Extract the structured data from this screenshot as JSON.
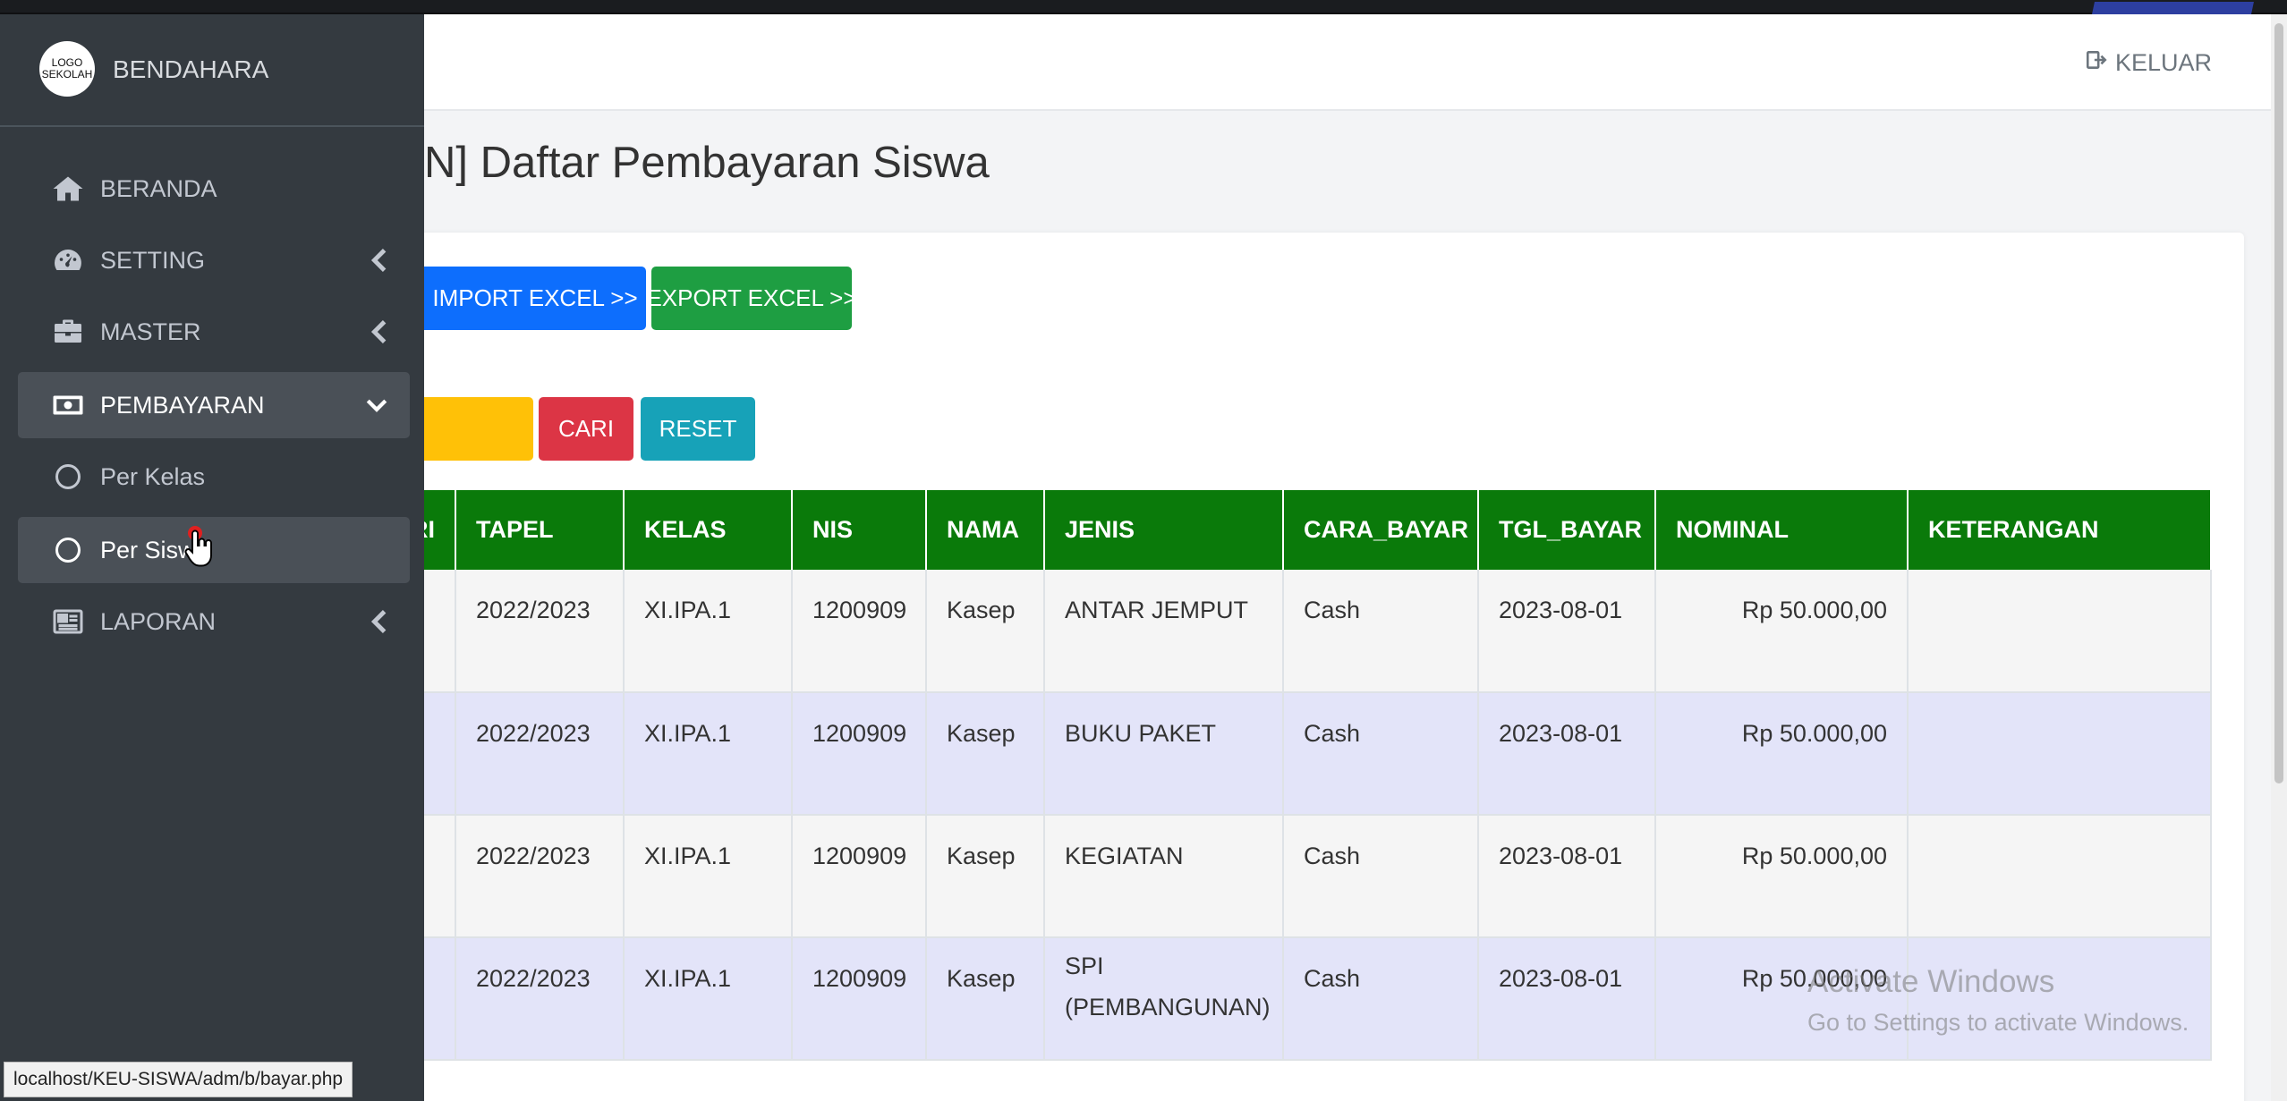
{
  "app": {
    "brand": "BENDAHARA",
    "logo_text_line1": "LOGO",
    "logo_text_line2": "SEKOLAH"
  },
  "sidebar": {
    "items": [
      {
        "label": "BERANDA",
        "icon": "home-icon"
      },
      {
        "label": "SETTING",
        "icon": "tachometer-icon"
      },
      {
        "label": "MASTER",
        "icon": "briefcase-icon"
      },
      {
        "label": "PEMBAYARAN",
        "icon": "money-bill-icon"
      },
      {
        "label": "Per Kelas",
        "icon": "circle-icon"
      },
      {
        "label": "Per Siswa",
        "icon": "circle-icon"
      },
      {
        "label": "LAPORAN",
        "icon": "newspaper-icon"
      }
    ]
  },
  "header": {
    "logout_label": "KELUAR"
  },
  "page": {
    "title": "N] Daftar Pembayaran Siswa"
  },
  "toolbar": {
    "import_label": "IMPORT EXCEL >>",
    "export_label": "EXPORT EXCEL >>",
    "search_label": "CARI",
    "reset_label": "RESET"
  },
  "table": {
    "columns": [
      "ENTRI",
      "TAPEL",
      "KELAS",
      "NIS",
      "NAMA",
      "JENIS",
      "CARA_BAYAR",
      "TGL_BAYAR",
      "NOMINAL",
      "KETERANGAN"
    ],
    "rows": [
      {
        "entri": "",
        "tapel": "2022/2023",
        "kelas": "XI.IPA.1",
        "nis": "1200909",
        "nama": "Kasep",
        "jenis": "ANTAR JEMPUT",
        "cara_bayar": "Cash",
        "tgl_bayar": "2023-08-01",
        "nominal": "Rp 50.000,00",
        "keterangan": ""
      },
      {
        "entri": "",
        "tapel": "2022/2023",
        "kelas": "XI.IPA.1",
        "nis": "1200909",
        "nama": "Kasep",
        "jenis": "BUKU PAKET",
        "cara_bayar": "Cash",
        "tgl_bayar": "2023-08-01",
        "nominal": "Rp 50.000,00",
        "keterangan": ""
      },
      {
        "entri": "",
        "tapel": "2022/2023",
        "kelas": "XI.IPA.1",
        "nis": "1200909",
        "nama": "Kasep",
        "jenis": "KEGIATAN",
        "cara_bayar": "Cash",
        "tgl_bayar": "2023-08-01",
        "nominal": "Rp 50.000,00",
        "keterangan": ""
      },
      {
        "entri": "",
        "tapel": "2022/2023",
        "kelas": "XI.IPA.1",
        "nis": "1200909",
        "nama": "Kasep",
        "jenis": "SPI (PEMBANGUNAN)",
        "cara_bayar": "Cash",
        "tgl_bayar": "2023-08-01",
        "nominal": "Rp 50.000,00",
        "keterangan": ""
      }
    ]
  },
  "statusbar": {
    "url": "localhost/KEU-SISWA/adm/b/bayar.php"
  },
  "watermark": {
    "line1": "Activate Windows",
    "line2": "Go to Settings to activate Windows."
  },
  "colors": {
    "sidebar_bg": "#343a40",
    "table_header": "#0a7a0a",
    "import": "#0d6efd",
    "export": "#1e9e42",
    "cari": "#dc3545",
    "reset": "#17a2b8",
    "yellow": "#ffc107"
  }
}
